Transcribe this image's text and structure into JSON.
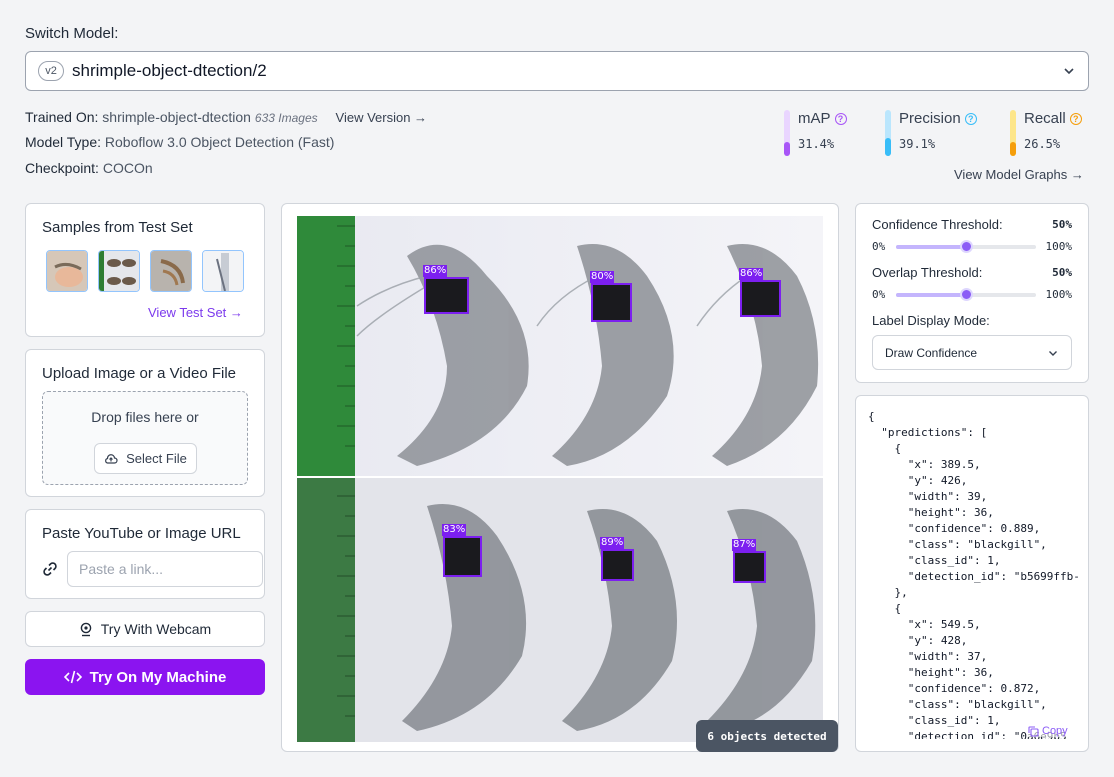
{
  "switch_model": {
    "label": "Switch Model:",
    "version_badge": "v2",
    "model_name": "shrimple-object-dtection/2"
  },
  "model_info": {
    "trained_on_label": "Trained On:",
    "trained_on_value": "shrimple-object-dtection",
    "image_count": "633 Images",
    "view_version": "View Version →",
    "model_type_label": "Model Type:",
    "model_type_value": "Roboflow 3.0 Object Detection (Fast)",
    "checkpoint_label": "Checkpoint:",
    "checkpoint_value": "COCOn"
  },
  "metrics": [
    {
      "name": "mAP",
      "value": "31.4%",
      "fraction": 0.314,
      "color": "#a855f7",
      "track": "#e9d5ff"
    },
    {
      "name": "Precision",
      "value": "39.1%",
      "fraction": 0.391,
      "color": "#38bdf8",
      "track": "#bae6fd"
    },
    {
      "name": "Recall",
      "value": "26.5%",
      "fraction": 0.265,
      "color": "#f59e0b",
      "track": "#fde68a"
    }
  ],
  "view_model_graphs": "View Model Graphs →",
  "samples": {
    "title": "Samples from Test Set",
    "view_test_set": "View Test Set →"
  },
  "upload": {
    "title": "Upload Image or a Video File",
    "drop_text": "Drop files here or",
    "select_file": "Select File"
  },
  "paste": {
    "title": "Paste YouTube or Image URL",
    "placeholder": "Paste a link..."
  },
  "webcam_button": "Try With Webcam",
  "machine_button": "Try On My Machine",
  "detections": [
    {
      "label": "86%"
    },
    {
      "label": "80%"
    },
    {
      "label": "86%"
    },
    {
      "label": "83%"
    },
    {
      "label": "89%"
    },
    {
      "label": "87%"
    }
  ],
  "objects_detected": "6 objects detected",
  "controls": {
    "confidence_label": "Confidence Threshold:",
    "confidence_value": "50%",
    "confidence_fraction": 0.5,
    "overlap_label": "Overlap Threshold:",
    "overlap_value": "50%",
    "overlap_fraction": 0.5,
    "min": "0%",
    "max": "100%",
    "display_mode_label": "Label Display Mode:",
    "display_mode_value": "Draw Confidence"
  },
  "json_output": "{\n  \"predictions\": [\n    {\n      \"x\": 389.5,\n      \"y\": 426,\n      \"width\": 39,\n      \"height\": 36,\n      \"confidence\": 0.889,\n      \"class\": \"blackgill\",\n      \"class_id\": 1,\n      \"detection_id\": \"b5699ffb-\n    },\n    {\n      \"x\": 549.5,\n      \"y\": 428,\n      \"width\": 37,\n      \"height\": 36,\n      \"confidence\": 0.872,\n      \"class\": \"blackgill\",\n      \"class_id\": 1,\n      \"detection_id\": \"0a6e9b5\n",
  "copy_label": "Copy"
}
